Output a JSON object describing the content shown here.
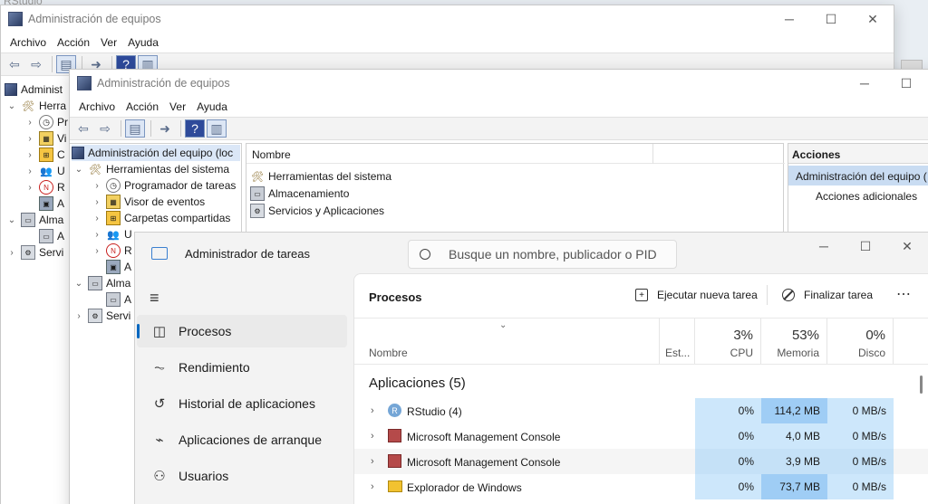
{
  "bg_app": {
    "title": "RStudio"
  },
  "back_window": {
    "title": "Administración de equipos",
    "menu": [
      "Archivo",
      "Acción",
      "Ver",
      "Ayuda"
    ],
    "tree": [
      {
        "label": "Administ",
        "icon": "computer-icon"
      },
      {
        "label": "Herra",
        "icon": "tools-icon"
      },
      {
        "label": "Pr",
        "icon": "clock-icon"
      },
      {
        "label": "Vi",
        "icon": "event-viewer-icon"
      },
      {
        "label": "C",
        "icon": "shared-folder-icon"
      },
      {
        "label": "U",
        "icon": "users-icon"
      },
      {
        "label": "R",
        "icon": "performance-icon"
      },
      {
        "label": "A",
        "icon": "device-manager-icon"
      },
      {
        "label": "Alma",
        "icon": "storage-icon"
      },
      {
        "label": "A",
        "icon": "disk-icon"
      },
      {
        "label": "Servi",
        "icon": "services-icon"
      }
    ]
  },
  "front_window": {
    "title": "Administración de equipos",
    "menu": [
      "Archivo",
      "Acción",
      "Ver",
      "Ayuda"
    ],
    "tree": [
      {
        "label": "Administración del equipo (loc"
      },
      {
        "label": "Herramientas del sistema"
      },
      {
        "label": "Programador de tareas"
      },
      {
        "label": "Visor de eventos"
      },
      {
        "label": "Carpetas compartidas"
      },
      {
        "label": "U"
      },
      {
        "label": "R"
      },
      {
        "label": "A"
      },
      {
        "label": "Alma"
      },
      {
        "label": "A"
      },
      {
        "label": "Servi"
      }
    ],
    "list_header": "Nombre",
    "list_items": [
      "Herramientas del sistema",
      "Almacenamiento",
      "Servicios y Aplicaciones"
    ],
    "actions_header": "Acciones",
    "actions_selected": "Administración del equipo (",
    "actions_more": "Acciones adicionales"
  },
  "task_manager": {
    "title": "Administrador de tareas",
    "search_placeholder": "Busque un nombre, publicador o PID",
    "nav": [
      "Procesos",
      "Rendimiento",
      "Historial de aplicaciones",
      "Aplicaciones de arranque",
      "Usuarios"
    ],
    "toolbar": {
      "title": "Procesos",
      "new_task": "Ejecutar nueva tarea",
      "end_task": "Finalizar tarea"
    },
    "columns": {
      "name": "Nombre",
      "status": "Est...",
      "cpu": {
        "pct": "3%",
        "label": "CPU"
      },
      "memory": {
        "pct": "53%",
        "label": "Memoria"
      },
      "disk": {
        "pct": "0%",
        "label": "Disco"
      }
    },
    "group": "Aplicaciones (5)",
    "rows": [
      {
        "name": "RStudio (4)",
        "cpu": "0%",
        "mem": "114,2 MB",
        "disk": "0 MB/s"
      },
      {
        "name": "Microsoft Management Console",
        "cpu": "0%",
        "mem": "4,0 MB",
        "disk": "0 MB/s"
      },
      {
        "name": "Microsoft Management Console",
        "cpu": "0%",
        "mem": "3,9 MB",
        "disk": "0 MB/s"
      },
      {
        "name": "Explorador de Windows",
        "cpu": "0%",
        "mem": "73,7 MB",
        "disk": "0 MB/s"
      }
    ]
  }
}
